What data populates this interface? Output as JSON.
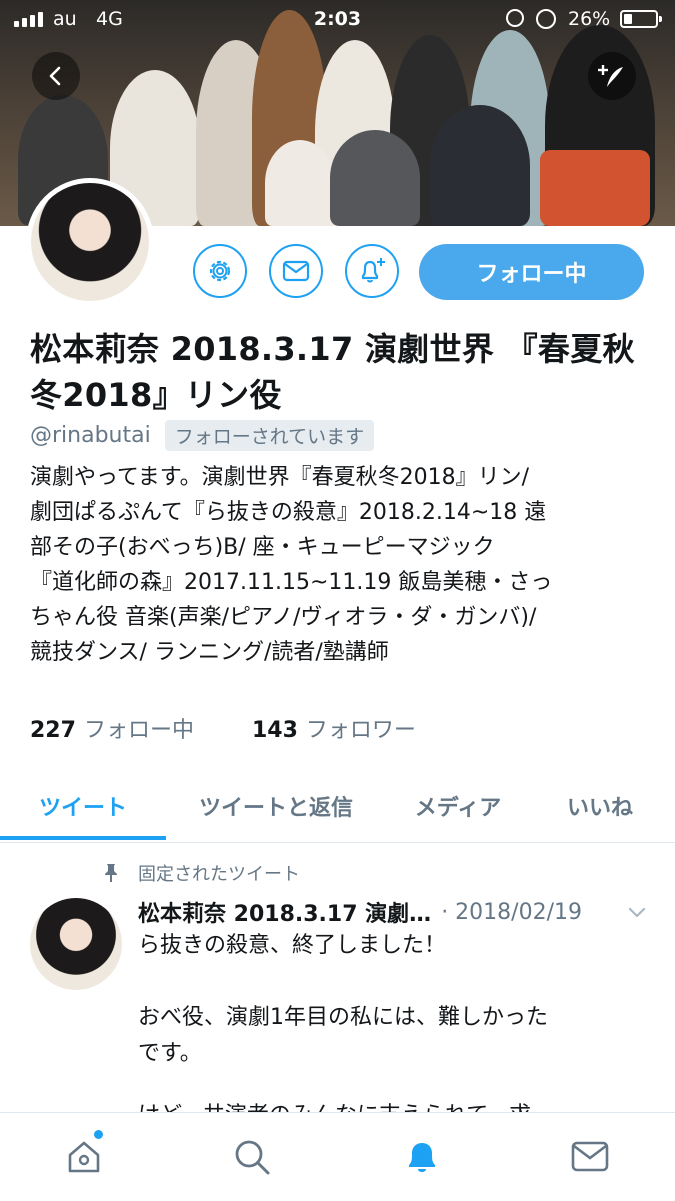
{
  "status_bar": {
    "carrier": "au",
    "network": "4G",
    "time": "2:03",
    "battery_percent": "26%",
    "battery_level": 0.26
  },
  "profile": {
    "display_name": "松本莉奈 2018.3.17 演劇世界 『春夏秋冬2018』リン役",
    "handle": "@rinabutai",
    "follows_you": "フォローされています",
    "follow_button_label": "フォロー中",
    "bio_lines": [
      "演劇やってます。演劇世界『春夏秋冬2018』リン/",
      "劇団ぱるぷんて『ら抜きの殺意』2018.2.14~18 遠",
      "部その子(おべっち)B/ 座・キューピーマジック",
      "『道化師の森』2017.11.15~11.19 飯島美穂・さっ",
      "ちゃん役 音楽(声楽/ピアノ/ヴィオラ・ダ・ガンバ)/",
      "競技ダンス/ ランニング/読者/塾講師"
    ],
    "following_count": "227",
    "following_label": "フォロー中",
    "followers_count": "143",
    "followers_label": "フォロワー"
  },
  "tabs": [
    "ツイート",
    "ツイートと返信",
    "メディア",
    "いいね"
  ],
  "active_tab": "ツイート",
  "tweet": {
    "pinned_label": "固定されたツイート",
    "author": "松本莉奈 2018.3.17 演劇…",
    "date": "· 2018/02/19",
    "text_lines": [
      "ら抜きの殺意、終了しました！",
      "",
      "おべ役、演劇1年目の私には、難しかった",
      "です。",
      ""
    ],
    "cut_line": "けど、共演者のみんなに支えられて、求"
  },
  "icons": {
    "back": "back-arrow-icon",
    "compose": "compose-icon",
    "settings": "gear-icon",
    "message": "envelope-icon",
    "notify": "bell-plus-icon",
    "pin": "pin-icon",
    "caret": "chevron-down-icon",
    "tabbar": [
      "home-icon",
      "search-icon",
      "bell-icon",
      "envelope-icon"
    ]
  },
  "colors": {
    "accent": "#1da1f2",
    "follow_button": "#4aa8ec",
    "secondary_text": "#657786"
  }
}
